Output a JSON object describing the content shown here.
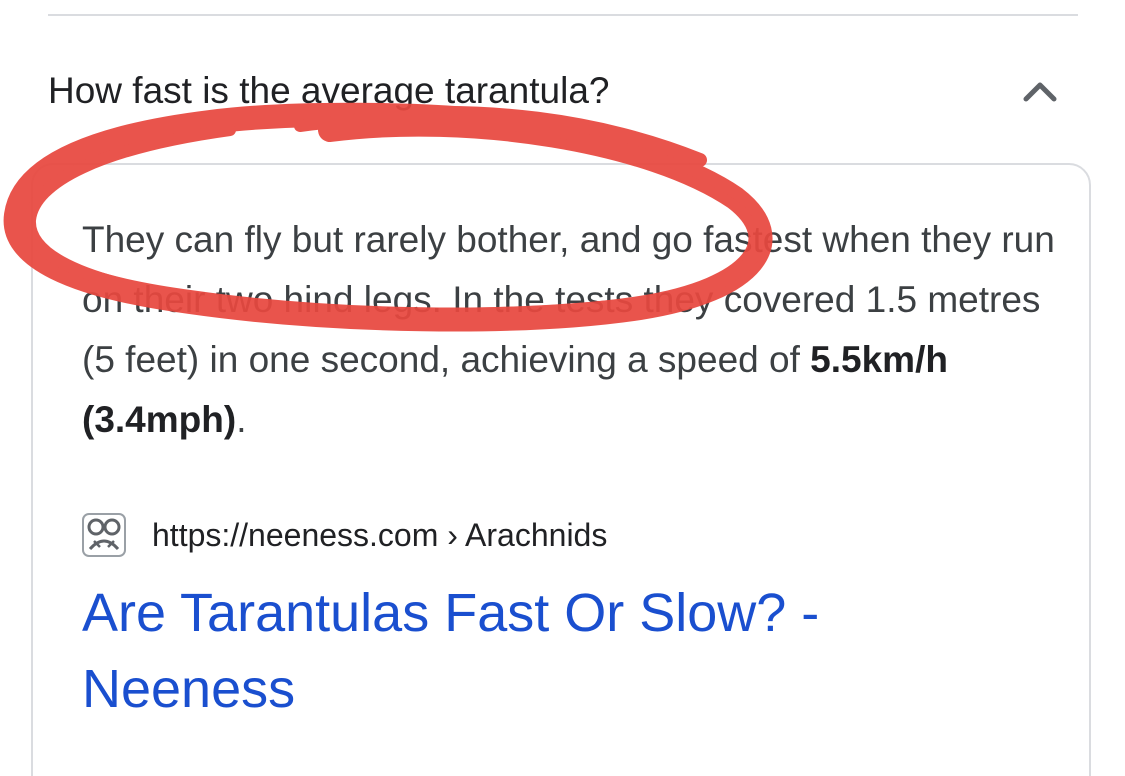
{
  "faq": {
    "question": "How fast is the average tarantula?",
    "answer": {
      "before_bold": "They can fly but rarely bother, and go fastest when they run on their two hind legs. In the tests they covered 1.5 metres (5 feet) in one second, achieving a speed of ",
      "bold": "5.5km/h (3.4mph)",
      "after_bold": "."
    },
    "source": {
      "url": "https://neeness.com › Arachnids",
      "icon": "neeness-favicon"
    },
    "result_title": "Are Tarantulas Fast Or Slow? - Neeness"
  },
  "annotation": {
    "color": "#e8483f",
    "shape": "hand-drawn-ellipse"
  },
  "colors": {
    "link": "#1a4fcf",
    "text": "#3c4043",
    "border": "#dadce0"
  }
}
